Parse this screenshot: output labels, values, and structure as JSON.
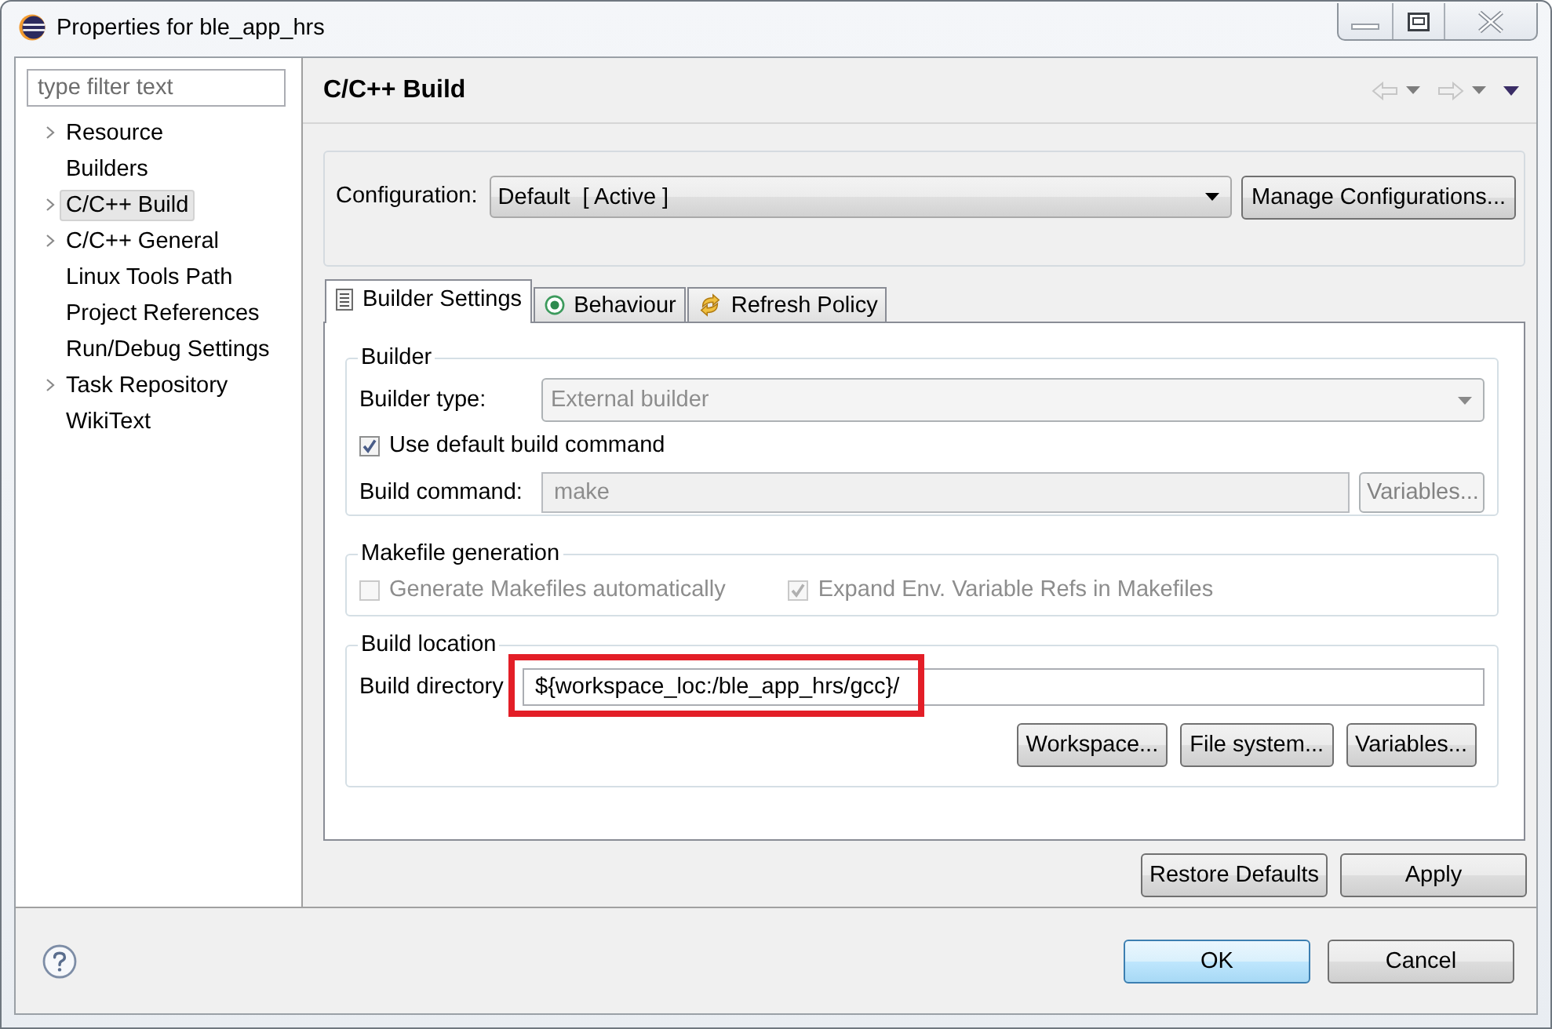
{
  "window": {
    "title": "Properties for ble_app_hrs"
  },
  "sidebar": {
    "filter": {
      "placeholder": "type filter text"
    },
    "items": [
      {
        "label": "Resource",
        "expandable": true,
        "expanded": false,
        "selected": false
      },
      {
        "label": "Builders",
        "expandable": false,
        "expanded": false,
        "selected": false
      },
      {
        "label": "C/C++ Build",
        "expandable": true,
        "expanded": false,
        "selected": true
      },
      {
        "label": "C/C++ General",
        "expandable": true,
        "expanded": false,
        "selected": false
      },
      {
        "label": "Linux Tools Path",
        "expandable": false,
        "expanded": false,
        "selected": false
      },
      {
        "label": "Project References",
        "expandable": false,
        "expanded": false,
        "selected": false
      },
      {
        "label": "Run/Debug Settings",
        "expandable": false,
        "expanded": false,
        "selected": false
      },
      {
        "label": "Task Repository",
        "expandable": true,
        "expanded": false,
        "selected": false
      },
      {
        "label": "WikiText",
        "expandable": false,
        "expanded": false,
        "selected": false
      }
    ]
  },
  "page": {
    "title": "C/C++ Build",
    "navigation": [
      {
        "kind": "back",
        "disabled": true
      },
      {
        "kind": "forward",
        "disabled": true
      }
    ],
    "configuration": {
      "label": "Configuration:",
      "value": "Default  [ Active ]",
      "manage_button": "Manage Configurations..."
    }
  },
  "tabs": [
    {
      "label": "Builder Settings",
      "kind": "list",
      "selected": true
    },
    {
      "label": "Behaviour",
      "kind": "radio",
      "selected": false
    },
    {
      "label": "Refresh Policy",
      "kind": "refresh",
      "selected": false
    }
  ],
  "builder": {
    "title": "Builder",
    "builder_type": {
      "label": "Builder type:",
      "value": "External builder",
      "disabled": true
    },
    "use_default_command": {
      "label": "Use default build command",
      "checked": true,
      "disabled": false
    },
    "build_command": {
      "label": "Build command:",
      "value": "make",
      "disabled": true
    },
    "variables_button": {
      "label": "Variables...",
      "disabled": true
    }
  },
  "makefile_generation": {
    "title": "Makefile generation",
    "options": [
      {
        "label": "Generate Makefiles automatically",
        "checked": false,
        "disabled": true
      },
      {
        "label": "Expand Env. Variable Refs in Makefiles",
        "checked": true,
        "disabled": true
      }
    ]
  },
  "build_location": {
    "title": "Build location",
    "build_directory": {
      "label": "Build directory",
      "value": "${workspace_loc:/ble_app_hrs/gcc}/",
      "highlighted": true
    },
    "buttons": [
      "Workspace...",
      "File system...",
      "Variables..."
    ]
  },
  "page_buttons": [
    "Restore Defaults",
    "Apply"
  ],
  "dialog_buttons": [
    {
      "label": "OK",
      "default": true
    },
    {
      "label": "Cancel",
      "default": false
    }
  ]
}
